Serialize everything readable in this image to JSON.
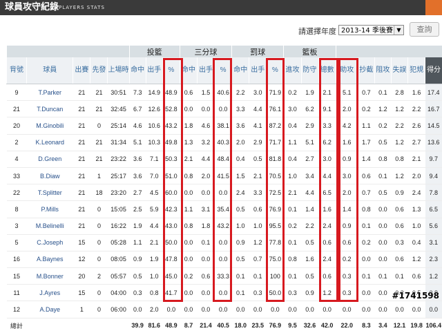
{
  "title_bar": {
    "title": "球員攻守紀錄",
    "subtitle": "PLAYERS STATS"
  },
  "filter": {
    "label": "請選擇年度",
    "season": "2013-14 季後賽",
    "search_label": "查詢"
  },
  "groups": {
    "fg": "投籃",
    "three": "三分球",
    "ft": "罰球",
    "reb": "籃板"
  },
  "headers": {
    "num": "背號",
    "player": "球員",
    "gp": "出賽",
    "gs": "先發",
    "min": "上場時間",
    "fgm": "命中",
    "fga": "出手",
    "fgp": "%",
    "tpm": "命中",
    "tpa": "出手",
    "tpp": "%",
    "ftm": "命中",
    "fta": "出手",
    "ftp": "%",
    "oreb": "進攻",
    "dreb": "防守",
    "treb": "總數",
    "ast": "助攻",
    "stl": "抄截",
    "blk": "阻攻",
    "tov": "失誤",
    "pf": "犯規",
    "pts": "得分"
  },
  "players": [
    [
      "9",
      "T.Parker",
      "21",
      "21",
      "30:51",
      "7.3",
      "14.9",
      "48.9",
      "0.6",
      "1.5",
      "40.6",
      "2.2",
      "3.0",
      "71.9",
      "0.2",
      "1.9",
      "2.1",
      "5.1",
      "0.7",
      "0.1",
      "2.8",
      "1.6",
      "17.4"
    ],
    [
      "21",
      "T.Duncan",
      "21",
      "21",
      "32:45",
      "6.7",
      "12.6",
      "52.8",
      "0.0",
      "0.0",
      "0.0",
      "3.3",
      "4.4",
      "76.1",
      "3.0",
      "6.2",
      "9.1",
      "2.0",
      "0.2",
      "1.2",
      "1.2",
      "2.2",
      "16.7"
    ],
    [
      "20",
      "M.Ginobili",
      "21",
      "0",
      "25:14",
      "4.6",
      "10.6",
      "43.2",
      "1.8",
      "4.6",
      "38.1",
      "3.6",
      "4.1",
      "87.2",
      "0.4",
      "2.9",
      "3.3",
      "4.2",
      "1.1",
      "0.2",
      "2.2",
      "2.6",
      "14.5"
    ],
    [
      "2",
      "K.Leonard",
      "21",
      "21",
      "31:34",
      "5.1",
      "10.3",
      "49.8",
      "1.3",
      "3.2",
      "40.3",
      "2.0",
      "2.9",
      "71.7",
      "1.1",
      "5.1",
      "6.2",
      "1.6",
      "1.7",
      "0.5",
      "1.2",
      "2.7",
      "13.6"
    ],
    [
      "4",
      "D.Green",
      "21",
      "21",
      "23:22",
      "3.6",
      "7.1",
      "50.3",
      "2.1",
      "4.4",
      "48.4",
      "0.4",
      "0.5",
      "81.8",
      "0.4",
      "2.7",
      "3.0",
      "0.9",
      "1.4",
      "0.8",
      "0.8",
      "2.1",
      "9.7"
    ],
    [
      "33",
      "B.Diaw",
      "21",
      "1",
      "25:17",
      "3.6",
      "7.0",
      "51.0",
      "0.8",
      "2.0",
      "41.5",
      "1.5",
      "2.1",
      "70.5",
      "1.0",
      "3.4",
      "4.4",
      "3.0",
      "0.6",
      "0.1",
      "1.2",
      "2.0",
      "9.4"
    ],
    [
      "22",
      "T.Splitter",
      "21",
      "18",
      "23:20",
      "2.7",
      "4.5",
      "60.0",
      "0.0",
      "0.0",
      "0.0",
      "2.4",
      "3.3",
      "72.5",
      "2.1",
      "4.4",
      "6.5",
      "2.0",
      "0.7",
      "0.5",
      "0.9",
      "2.4",
      "7.8"
    ],
    [
      "8",
      "P.Mills",
      "21",
      "0",
      "15:05",
      "2.5",
      "5.9",
      "42.3",
      "1.1",
      "3.1",
      "35.4",
      "0.5",
      "0.6",
      "76.9",
      "0.1",
      "1.4",
      "1.6",
      "1.4",
      "0.8",
      "0.0",
      "0.6",
      "1.3",
      "6.5"
    ],
    [
      "3",
      "M.Belinelli",
      "21",
      "0",
      "16:22",
      "1.9",
      "4.4",
      "43.0",
      "0.8",
      "1.8",
      "43.2",
      "1.0",
      "1.0",
      "95.5",
      "0.2",
      "2.2",
      "2.4",
      "0.9",
      "0.1",
      "0.0",
      "0.6",
      "1.0",
      "5.6"
    ],
    [
      "5",
      "C.Joseph",
      "15",
      "0",
      "05:28",
      "1.1",
      "2.1",
      "50.0",
      "0.0",
      "0.1",
      "0.0",
      "0.9",
      "1.2",
      "77.8",
      "0.1",
      "0.5",
      "0.6",
      "0.6",
      "0.2",
      "0.0",
      "0.3",
      "0.4",
      "3.1"
    ],
    [
      "16",
      "A.Baynes",
      "12",
      "0",
      "08:05",
      "0.9",
      "1.9",
      "47.8",
      "0.0",
      "0.0",
      "0.0",
      "0.5",
      "0.7",
      "75.0",
      "0.8",
      "1.6",
      "2.4",
      "0.2",
      "0.0",
      "0.0",
      "0.6",
      "1.2",
      "2.3"
    ],
    [
      "15",
      "M.Bonner",
      "20",
      "2",
      "05:57",
      "0.5",
      "1.0",
      "45.0",
      "0.2",
      "0.6",
      "33.3",
      "0.1",
      "0.1",
      "100",
      "0.1",
      "0.5",
      "0.6",
      "0.3",
      "0.1",
      "0.1",
      "0.1",
      "0.6",
      "1.2"
    ],
    [
      "11",
      "J.Ayres",
      "15",
      "0",
      "04:00",
      "0.3",
      "0.8",
      "41.7",
      "0.0",
      "0.0",
      "0.0",
      "0.1",
      "0.3",
      "50.0",
      "0.3",
      "0.9",
      "1.2",
      "0.3",
      "0.0",
      "0.0",
      "0.3",
      "0.5",
      "0.8"
    ],
    [
      "12",
      "A.Daye",
      "1",
      "0",
      "06:00",
      "0.0",
      "2.0",
      "0.0",
      "0.0",
      "0.0",
      "0.0",
      "0.0",
      "0.0",
      "0.0",
      "0.0",
      "0.0",
      "0.0",
      "0.0",
      "0.0",
      "0.0",
      "0.0",
      "0.0",
      "0.0"
    ]
  ],
  "totals": [
    "總計",
    "",
    "",
    "",
    "",
    "39.9",
    "81.6",
    "48.9",
    "8.7",
    "21.4",
    "40.5",
    "18.0",
    "23.5",
    "76.9",
    "9.5",
    "32.6",
    "42.0",
    "22.0",
    "8.3",
    "3.4",
    "12.1",
    "19.8",
    "106.4"
  ],
  "watermark": "#1741598"
}
